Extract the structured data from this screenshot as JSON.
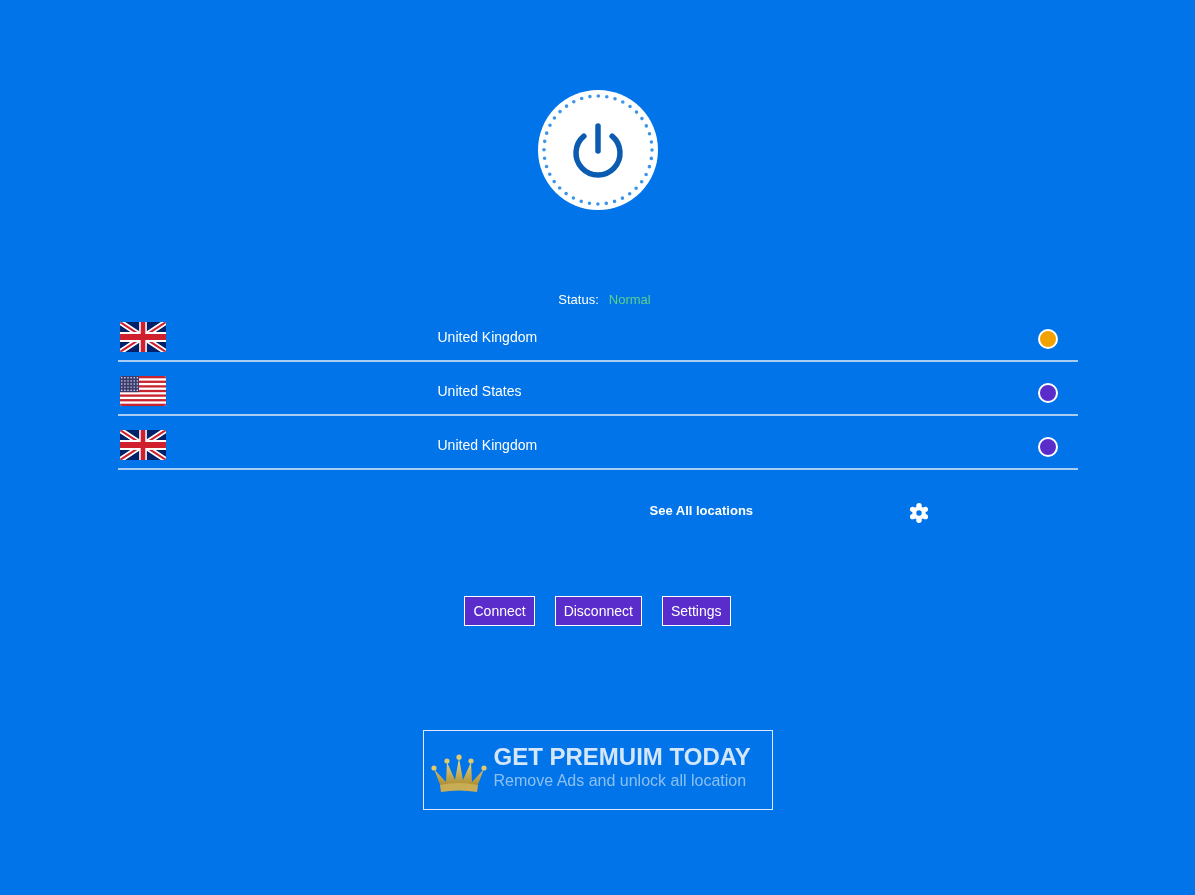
{
  "status": {
    "label": "Status:",
    "value": "Normal"
  },
  "locations": [
    {
      "kind": "uk",
      "country": "United Kingdom",
      "selected": true
    },
    {
      "kind": "us",
      "country": "United States",
      "selected": false
    },
    {
      "kind": "uk",
      "country": "United Kingdom",
      "selected": false
    }
  ],
  "see_all_link": "See All locations",
  "buttons": [
    "Connect",
    "Disconnect",
    "Settings"
  ],
  "premium_banner": {
    "title": "GET PREMUIM TODAY",
    "subtitle": "Remove Ads and unlock all location"
  }
}
